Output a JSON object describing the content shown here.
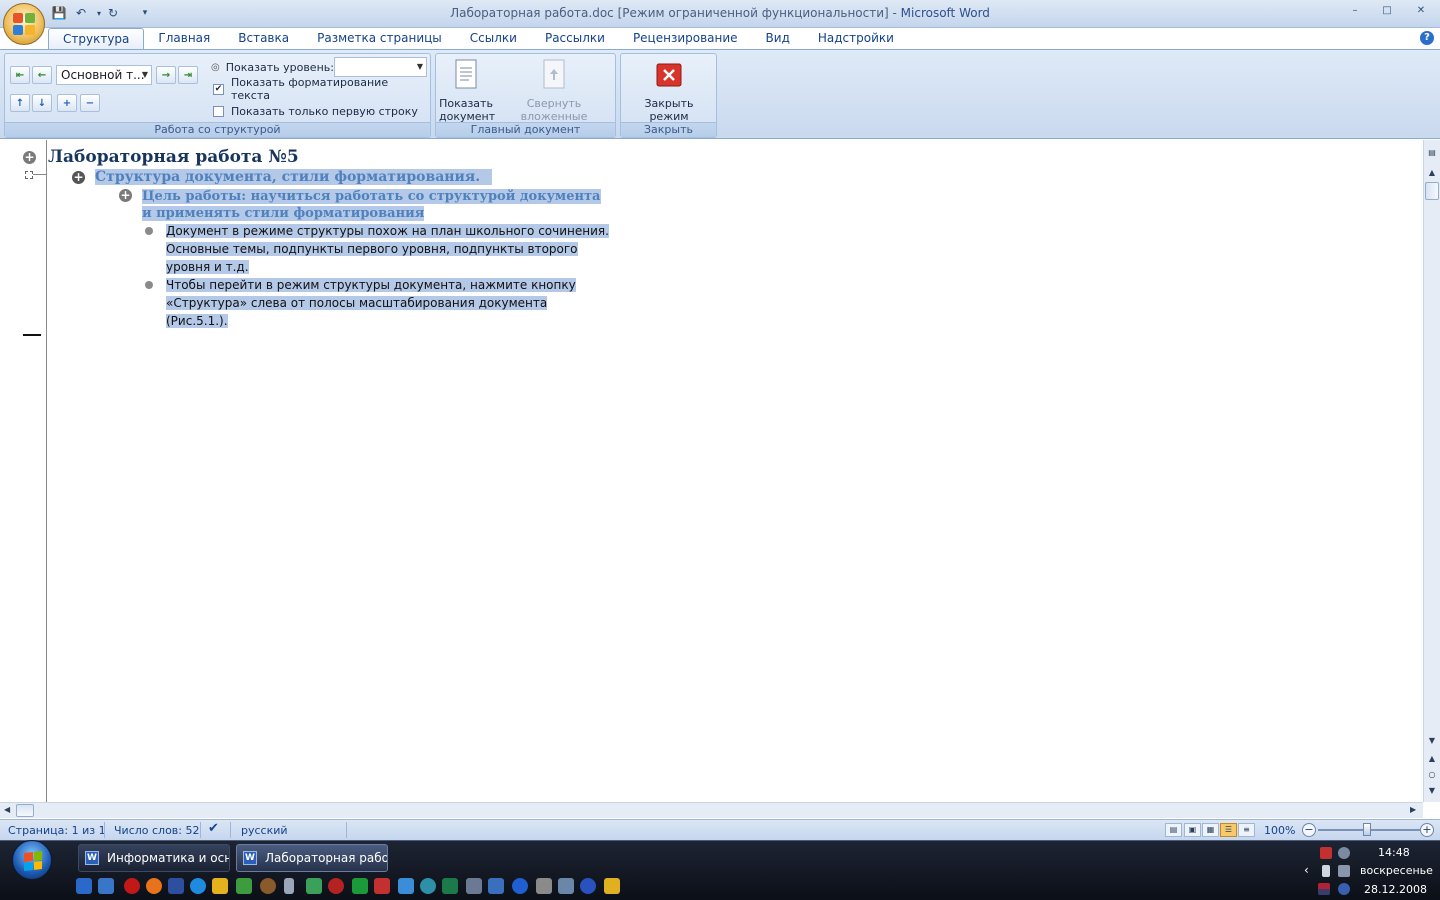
{
  "window": {
    "title": "Лабораторная работа.doc [Режим ограниченной функциональности] - ",
    "app_name": "Microsoft Word"
  },
  "tabs": [
    "Структура",
    "Главная",
    "Вставка",
    "Разметка страницы",
    "Ссылки",
    "Рассылки",
    "Рецензирование",
    "Вид",
    "Надстройки"
  ],
  "ribbon": {
    "outline_group": {
      "label": "Работа со структурой",
      "level_combo": "Основной т...",
      "show_level_label": "Показать уровень:",
      "show_level_value": "",
      "show_formatting_label": "Показать форматирование текста",
      "show_formatting_checked": true,
      "first_line_label": "Показать только первую строку",
      "first_line_checked": false
    },
    "master_group": {
      "label": "Главный документ",
      "show_doc": "Показать документ",
      "collapse_sub": "Свернуть вложенные документы"
    },
    "close_group": {
      "label": "Закрыть",
      "close_outline": "Закрыть режим структуры"
    }
  },
  "document": {
    "heading1": "Лабораторная работа №5",
    "heading2": "Структура документа, стили форматирования.",
    "heading3": "Цель работы: научиться работать со структурой документа и применять стили форматирования",
    "bullets": [
      "Документ в режиме структуры похож на план школьного сочинения. Основные темы, подпункты первого уровня, подпункты второго уровня и т.д.",
      "Чтобы перейти в режим структуры документа, нажмите кнопку «Структура» слева от полосы масштабирования документа (Рис.5.1.)."
    ]
  },
  "status": {
    "page": "Страница: 1 из 1",
    "words": "Число слов: 52",
    "language": "русский",
    "zoom": "100%",
    "zoom_percent": 100
  },
  "taskbar": {
    "buttons": [
      "Информатика и осно...",
      "Лабораторная рабо..."
    ],
    "active_index": 1,
    "time": "14:48",
    "day": "воскресенье",
    "date": "28.12.2008"
  },
  "colors": {
    "accent": "#15428b",
    "heading1": "#17365d",
    "heading_blue": "#4f81bd",
    "selection": "#b4c8e8",
    "close_red": "#d9342b"
  }
}
